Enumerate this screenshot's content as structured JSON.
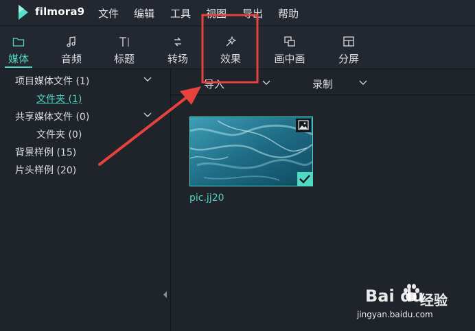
{
  "app": {
    "name": "filmora9",
    "accent": "#4fd8c3"
  },
  "menu": [
    "文件",
    "编辑",
    "工具",
    "视图",
    "导出",
    "帮助"
  ],
  "tools": [
    {
      "label": "媒体",
      "icon": "folder-icon",
      "active": true
    },
    {
      "label": "音频",
      "icon": "music-note-icon"
    },
    {
      "label": "标题",
      "icon": "text-title-icon"
    },
    {
      "label": "转场",
      "icon": "transition-icon"
    },
    {
      "label": "效果",
      "icon": "effects-icon"
    },
    {
      "label": "画中画",
      "icon": "pip-icon"
    },
    {
      "label": "分屏",
      "icon": "split-screen-icon"
    }
  ],
  "sidebar": {
    "items": [
      {
        "label": "项目媒体文件 (1)"
      },
      {
        "label": "文件夹 (1)",
        "selected": true
      },
      {
        "label": "共享媒体文件 (0)"
      },
      {
        "label": "文件夹 (0)"
      },
      {
        "label": "背景样例 (15)"
      },
      {
        "label": "片头样例 (20)"
      }
    ]
  },
  "content": {
    "import_label": "导入",
    "record_label": "录制",
    "media": [
      {
        "filename": "pic.jj20",
        "type_icon": "image-icon",
        "added": true
      }
    ]
  },
  "watermark": {
    "brand": "Bai du",
    "suffix": "经验",
    "url": "jingyan.baidu.com"
  },
  "annotation_color": "#e8423f"
}
